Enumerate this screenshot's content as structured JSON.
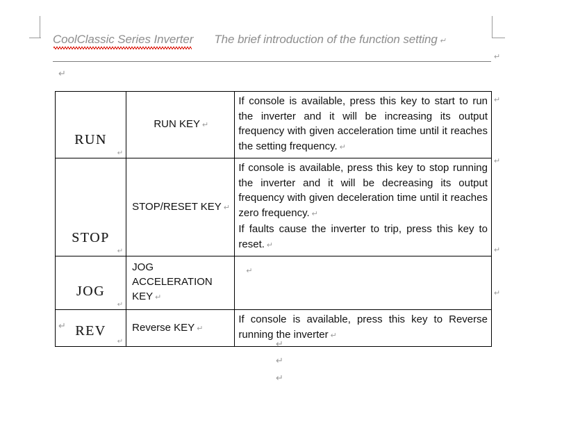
{
  "document": {
    "header": {
      "title_left": "CoolClassic Series Inverter",
      "title_right": "The brief introduction of the function setting",
      "misspelled_word": "CoolClassic",
      "spellcheck_underline_color": "#e02b20",
      "text_color": "#8d8d8d",
      "rule_color": "#7d7d7d"
    },
    "formatting_marks": {
      "pilcrow": "↵",
      "color": "#9b9b9b",
      "visible": true
    },
    "table": {
      "border_color": "#000000",
      "columns": [
        "key",
        "name",
        "description"
      ],
      "rows": [
        {
          "key": "RUN",
          "name": "RUN KEY",
          "description_paragraphs": [
            "If console is available, press this key to start to run the inverter and it will be increasing its output frequency with given acceleration time until it reaches the setting frequency."
          ]
        },
        {
          "key": "STOP",
          "name": "STOP/RESET KEY",
          "description_paragraphs": [
            "If console is available, press this key to stop running the inverter and it will be decreasing its output frequency with given deceleration time until it reaches zero frequency.",
            "If faults cause the inverter to trip, press this key to reset."
          ]
        },
        {
          "key": "JOG",
          "name": "JOG ACCELERATION KEY",
          "description_paragraphs": []
        },
        {
          "key": "REV",
          "name": "Reverse KEY",
          "description_paragraphs": [
            "If console is available, press this key to Reverse running the inverter"
          ]
        }
      ]
    }
  }
}
